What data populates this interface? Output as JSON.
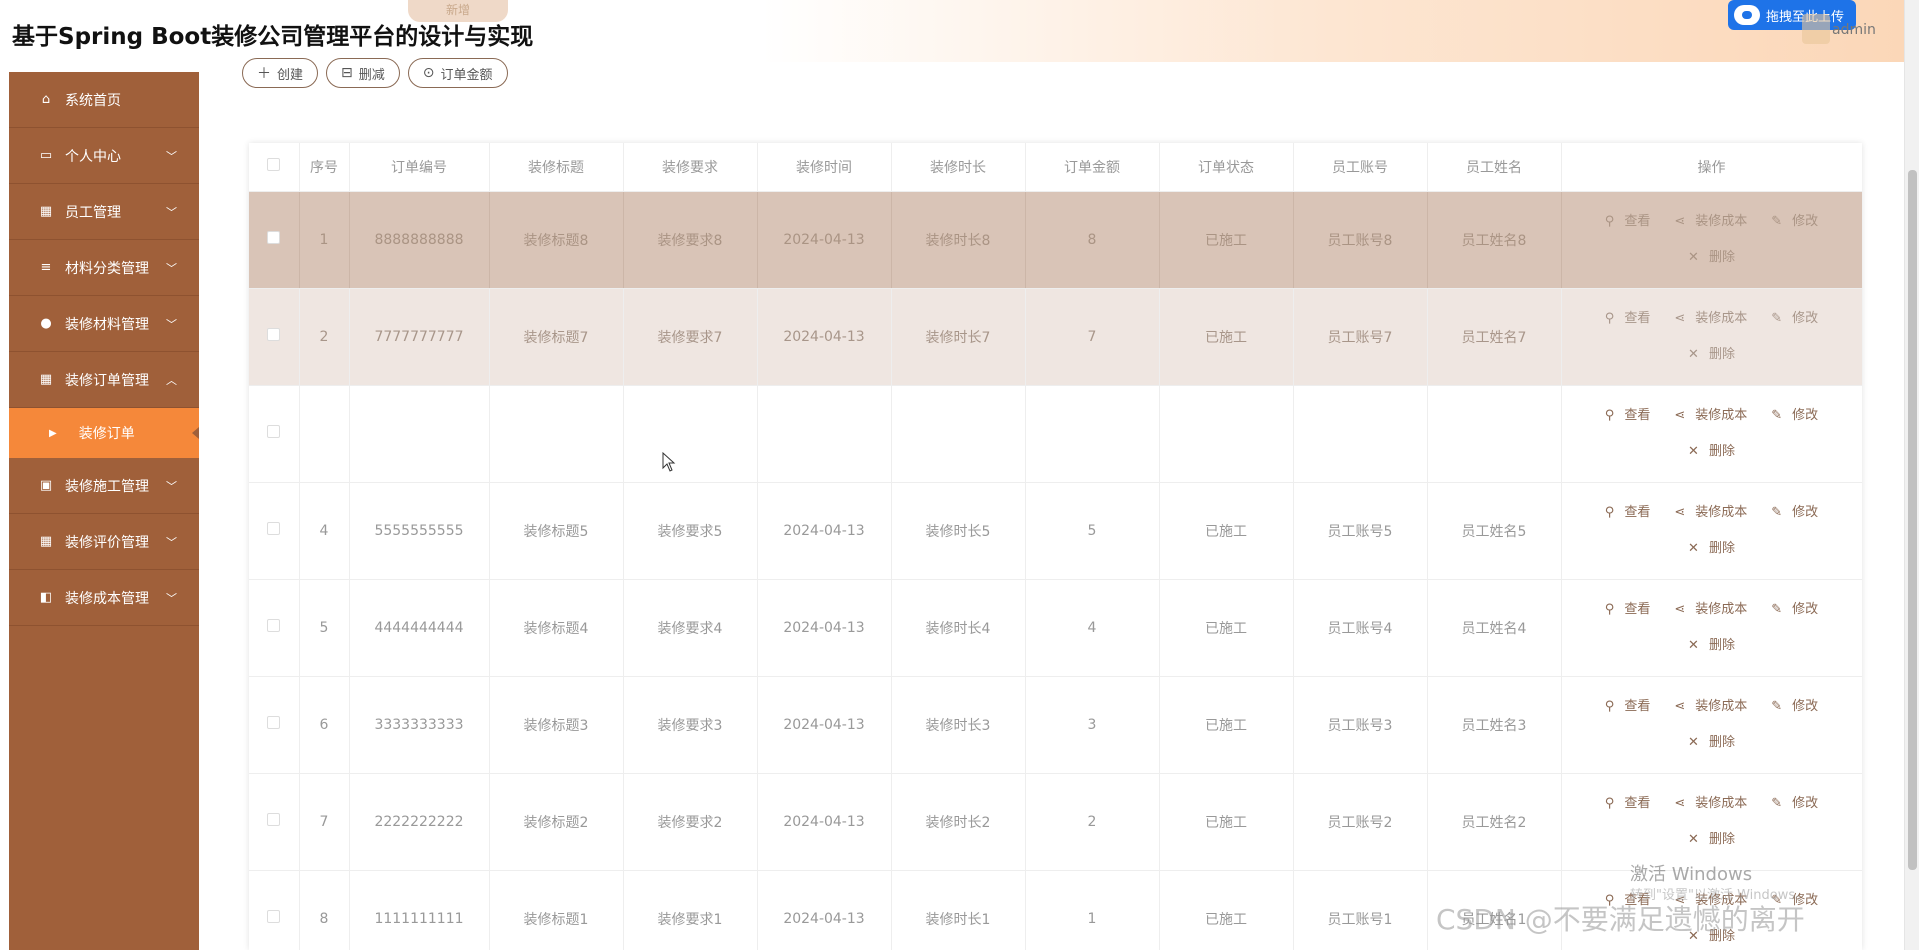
{
  "header": {
    "title": "基于Spring Boot装修公司管理平台的设计与实现",
    "upload_label": "拖拽至此上传",
    "user": "admin",
    "top_button": "新增"
  },
  "sidebar": {
    "items": [
      {
        "label": "系统首页",
        "icon": "home-icon",
        "chevron": ""
      },
      {
        "label": "个人中心",
        "icon": "wallet-icon",
        "chevron": "﹀"
      },
      {
        "label": "员工管理",
        "icon": "grid-icon",
        "chevron": "﹀"
      },
      {
        "label": "材料分类管理",
        "icon": "list-icon",
        "chevron": "﹀"
      },
      {
        "label": "装修材料管理",
        "icon": "bulb-icon",
        "chevron": "﹀"
      },
      {
        "label": "装修订单管理",
        "icon": "grid-icon",
        "chevron": "︿"
      },
      {
        "label": "装修施工管理",
        "icon": "clipboard-icon",
        "chevron": "﹀"
      },
      {
        "label": "装修评价管理",
        "icon": "grid-icon",
        "chevron": "﹀"
      },
      {
        "label": "装修成本管理",
        "icon": "briefcase-icon",
        "chevron": "﹀"
      }
    ],
    "sub_item": "装修订单"
  },
  "toolbar": {
    "create": "创建",
    "delete": "删减",
    "amount": "订单金额"
  },
  "table": {
    "headers": [
      "序号",
      "订单编号",
      "装修标题",
      "装修要求",
      "装修时间",
      "装修时长",
      "订单金额",
      "订单状态",
      "员工账号",
      "员工姓名",
      "操作"
    ],
    "rows": [
      [
        "1",
        "8888888888",
        "装修标题8",
        "装修要求8",
        "2024-04-13",
        "装修时长8",
        "8",
        "已施工",
        "员工账号8",
        "员工姓名8"
      ],
      [
        "2",
        "7777777777",
        "装修标题7",
        "装修要求7",
        "2024-04-13",
        "装修时长7",
        "7",
        "已施工",
        "员工账号7",
        "员工姓名7"
      ],
      [
        "",
        "",
        "",
        "",
        "",
        "",
        "",
        "",
        "",
        ""
      ],
      [
        "4",
        "5555555555",
        "装修标题5",
        "装修要求5",
        "2024-04-13",
        "装修时长5",
        "5",
        "已施工",
        "员工账号5",
        "员工姓名5"
      ],
      [
        "5",
        "4444444444",
        "装修标题4",
        "装修要求4",
        "2024-04-13",
        "装修时长4",
        "4",
        "已施工",
        "员工账号4",
        "员工姓名4"
      ],
      [
        "6",
        "3333333333",
        "装修标题3",
        "装修要求3",
        "2024-04-13",
        "装修时长3",
        "3",
        "已施工",
        "员工账号3",
        "员工姓名3"
      ],
      [
        "7",
        "2222222222",
        "装修标题2",
        "装修要求2",
        "2024-04-13",
        "装修时长2",
        "2",
        "已施工",
        "员工账号2",
        "员工姓名2"
      ],
      [
        "8",
        "1111111111",
        "装修标题1",
        "装修要求1",
        "2024-04-13",
        "装修时长1",
        "1",
        "已施工",
        "员工账号1",
        "员工姓名1"
      ]
    ],
    "ops": {
      "view": "查看",
      "cost": "装修成本",
      "edit": "修改",
      "delete": "删除"
    }
  },
  "watermark": {
    "activate": "激活 Windows",
    "activate_sub": "转到\"设置\"以激活 Windows。",
    "csdn": "CSDN @不要满足遗憾的离开"
  }
}
